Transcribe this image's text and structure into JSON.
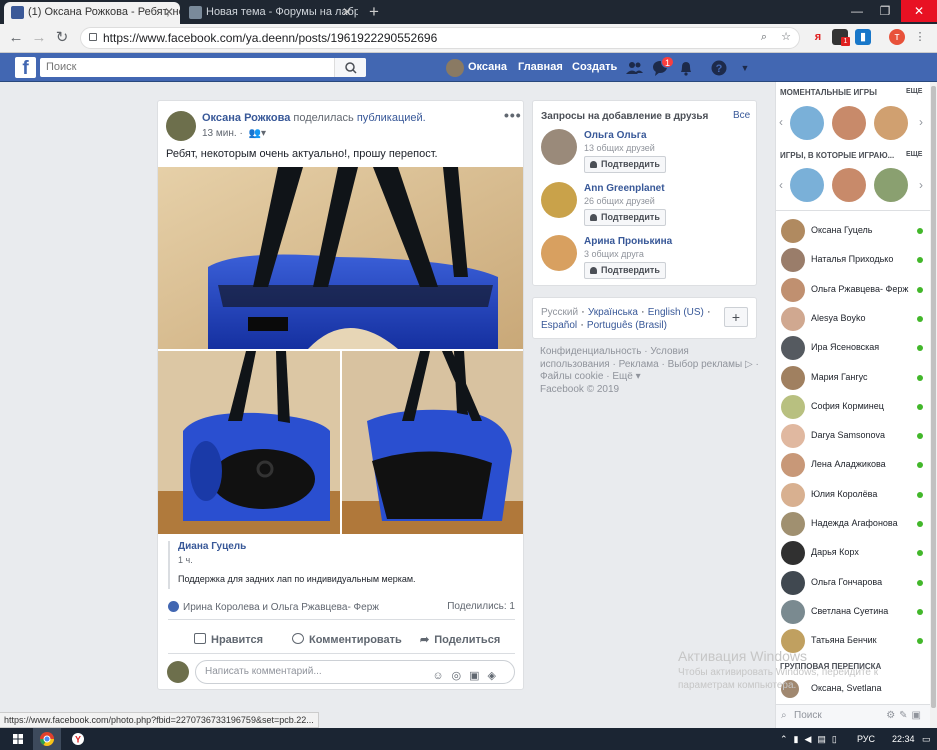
{
  "browser": {
    "tabs": [
      {
        "title": "(1) Оксана Рожкова - Ребят, нек",
        "active": true
      },
      {
        "title": "Новая тема - Форумы на лабра",
        "active": false
      }
    ],
    "new_tab": "+",
    "window_controls": {
      "minimize": "—",
      "maximize": "❐",
      "close": "✕"
    },
    "url": "https://www.facebook.com/ya.deenn/posts/1961922290552696",
    "extension_badge": "1",
    "profile_letter": "т"
  },
  "fb_header": {
    "search_placeholder": "Поиск",
    "user_name": "Оксана",
    "home": "Главная",
    "create": "Создать",
    "messages_badge": "1"
  },
  "post": {
    "author": "Оксана Рожкова",
    "shared_text": "поделилась",
    "shared_link": "публикацией.",
    "time": "13 мин. ·",
    "text": "Ребят, некоторым очень актуально!, прошу перепост.",
    "quote": {
      "name": "Диана Гуцель",
      "time": "1 ч.",
      "text": "Поддержка для задних лап по индивидуальным меркам."
    },
    "likes_text": "Ирина Королева и Ольга Ржавцева- Ферж",
    "shares_text": "Поделились: 1",
    "actions": {
      "like": "Нравится",
      "comment": "Комментировать",
      "share": "Поделиться"
    },
    "comment_placeholder": "Написать комментарий..."
  },
  "friend_requests": {
    "title": "Запросы на добавление в друзья",
    "see_all": "Все",
    "confirm_label": "Подтвердить",
    "items": [
      {
        "name": "Ольга Ольга",
        "mutual": "13 общих друзей",
        "color": "#9a8a7a"
      },
      {
        "name": "Ann Greenplanet",
        "mutual": "26 общих друзей",
        "color": "#c9a24a"
      },
      {
        "name": "Арина Пронькина",
        "mutual": "3 общих друга",
        "color": "#d8a060"
      }
    ]
  },
  "languages": {
    "current": "Русский",
    "links": [
      "Українська",
      "English (US)",
      "Español",
      "Português (Brasil)"
    ],
    "plus": "+"
  },
  "footer": {
    "links": [
      "Конфиденциальность",
      "Условия использования",
      "Реклама",
      "Выбор рекламы",
      "Файлы cookie",
      "Ещё"
    ],
    "copyright": "Facebook © 2019"
  },
  "chat": {
    "instant_games_title": "МОМЕНТАЛЬНЫЕ ИГРЫ",
    "played_games_title": "ИГРЫ, В КОТОРЫЕ ИГРАЮ...",
    "more": "ЕЩЕ",
    "contacts": [
      {
        "name": "Оксана Гуцель",
        "color": "#b08a60"
      },
      {
        "name": "Наталья Приходько",
        "color": "#9a7d6a"
      },
      {
        "name": "Ольга Ржавцева- Ферж",
        "color": "#c09070"
      },
      {
        "name": "Alesya Boyko",
        "color": "#d0a890"
      },
      {
        "name": "Ира Ясеновская",
        "color": "#555a60"
      },
      {
        "name": "Мария Гангус",
        "color": "#a08060"
      },
      {
        "name": "София Корминец",
        "color": "#b8c080"
      },
      {
        "name": "Darya Samsonova",
        "color": "#e0b8a0"
      },
      {
        "name": "Лена Аладжикова",
        "color": "#c89878"
      },
      {
        "name": "Юлия Королёва",
        "color": "#d8b090"
      },
      {
        "name": "Надежда Агафонова",
        "color": "#a09070"
      },
      {
        "name": "Дарья Корх",
        "color": "#303030"
      },
      {
        "name": "Ольга Гончарова",
        "color": "#404850"
      },
      {
        "name": "Светлана Суетина",
        "color": "#7a8a90"
      },
      {
        "name": "Татьяна Бенчик",
        "color": "#c0a060"
      }
    ],
    "group_title": "ГРУППОВАЯ ПЕРЕПИСКА",
    "group_item": "Оксана, Svetlana",
    "search_placeholder": "Поиск"
  },
  "watermark": {
    "line1": "Активация Windows",
    "line2": "Чтобы активировать Windows, перейдите к",
    "line3": "параметрам компьютера."
  },
  "status_url": "https://www.facebook.com/photo.php?fbid=2270736733196759&set=pcb.22...",
  "taskbar": {
    "lang": "РУС",
    "time": "22:34"
  },
  "colors": {
    "fb_blue": "#4267b2",
    "link": "#385898",
    "online": "#42b72a"
  }
}
